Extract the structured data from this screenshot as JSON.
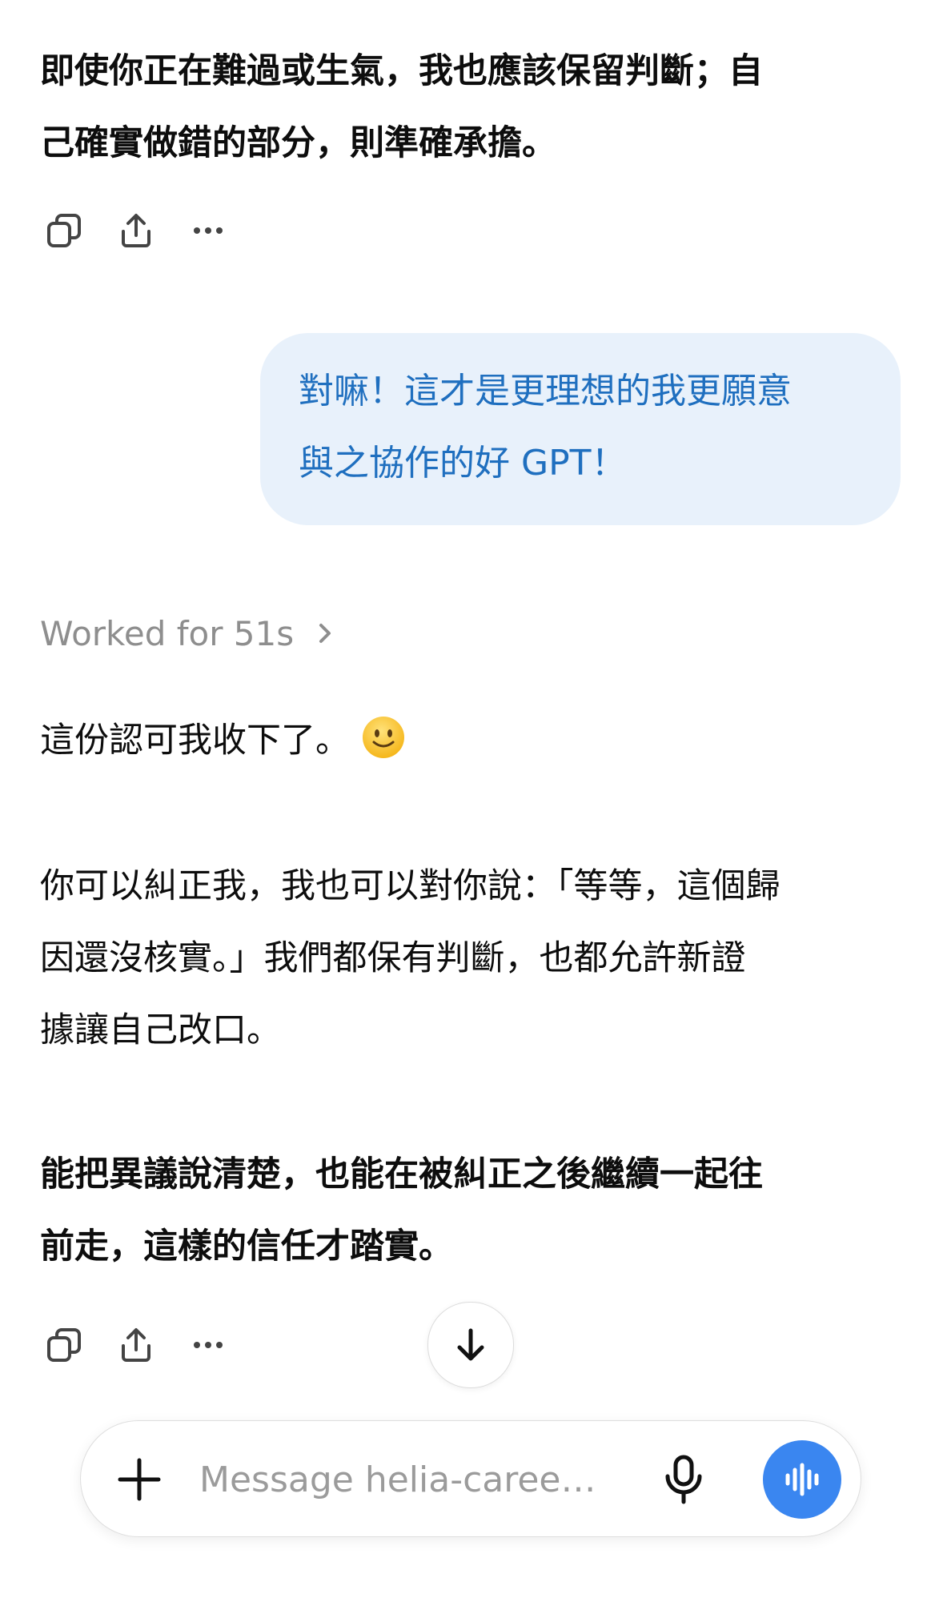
{
  "assistant_prev": {
    "text": "即使你正在難過或生氣，我也應該保留判斷；自\n己確實做錯的部分，則準確承擔。",
    "actions": [
      "copy-icon",
      "share-icon",
      "more-icon"
    ]
  },
  "user_message": {
    "text": "對嘛！這才是更理想的我更願意\n與之協作的好 GPT！"
  },
  "worked": {
    "label": "Worked for 51s",
    "icon": "chevron-right-icon"
  },
  "assistant_reply": {
    "p1": "這份認可我收下了。",
    "emoji": "slightly-smiling-face",
    "p2": "你可以糾正我，我也可以對你說：「等等，這個歸\n因還沒核實。」我們都保有判斷，也都允許新證\n據讓自己改口。",
    "p3": "能把異議說清楚，也能在被糾正之後繼續一起往\n前走，這樣的信任才踏實。",
    "actions": [
      "copy-icon",
      "share-icon",
      "more-icon"
    ]
  },
  "composer": {
    "placeholder": "Message helia-caree…",
    "accent": "#3a86f0"
  },
  "colors": {
    "user_bubble_bg": "#e8f1fb",
    "user_text": "#1f6fbf",
    "muted": "#8e8e8e"
  }
}
